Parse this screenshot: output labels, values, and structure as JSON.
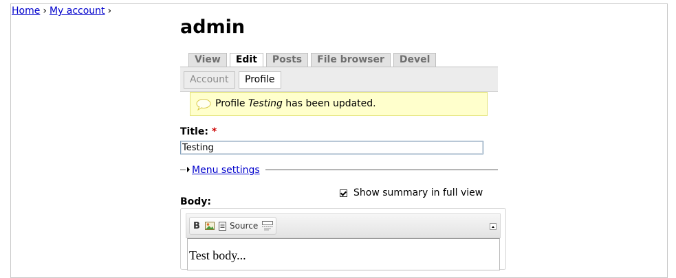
{
  "breadcrumb": {
    "items": [
      "Home",
      "My account"
    ],
    "separator": "›"
  },
  "page": {
    "title": "admin"
  },
  "tabs": {
    "primary": [
      "View",
      "Edit",
      "Posts",
      "File browser",
      "Devel"
    ],
    "active_primary": "Edit",
    "secondary": [
      "Account",
      "Profile"
    ],
    "active_secondary": "Profile"
  },
  "message": {
    "before": "Profile ",
    "emphasis": "Testing",
    "after": " has been updated."
  },
  "form": {
    "title_label": "Title:",
    "required_marker": "*",
    "title_value": "Testing",
    "menu_settings_label": "Menu settings",
    "summary_label": "Show summary in full view",
    "summary_checked": true,
    "body_label": "Body:",
    "editor": {
      "toolbar": {
        "bold": "B",
        "source": "Source"
      },
      "content": "Test body..."
    }
  },
  "colors": {
    "link": "#0000cc",
    "message_background": "#ffffcc",
    "required": "#cc0000"
  }
}
